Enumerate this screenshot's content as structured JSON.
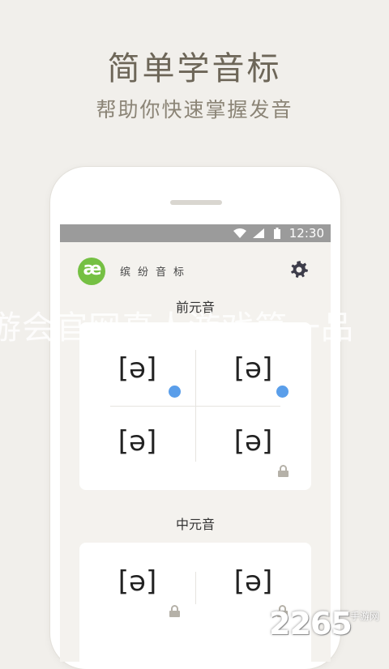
{
  "promo": {
    "headline": "简单学音标",
    "subheadline": "帮助你快速掌握发音"
  },
  "status_bar": {
    "time": "12:30"
  },
  "app": {
    "name": "缤纷音标",
    "logo_text": "æ"
  },
  "sections": [
    {
      "label": "前元音",
      "cells": [
        "[ə]",
        "[ə]",
        "[ə]",
        "[ə]"
      ]
    },
    {
      "label": "中元音",
      "cells": [
        "[ə]",
        "[ə]"
      ]
    }
  ],
  "watermark": "游会官网真人游戏第一品",
  "brand": {
    "number": "2265",
    "suffix": "手游网"
  },
  "colors": {
    "accent_dot": "#5a9eea",
    "logo_green": "#75c043",
    "status_bar": "#9b9b9b"
  }
}
